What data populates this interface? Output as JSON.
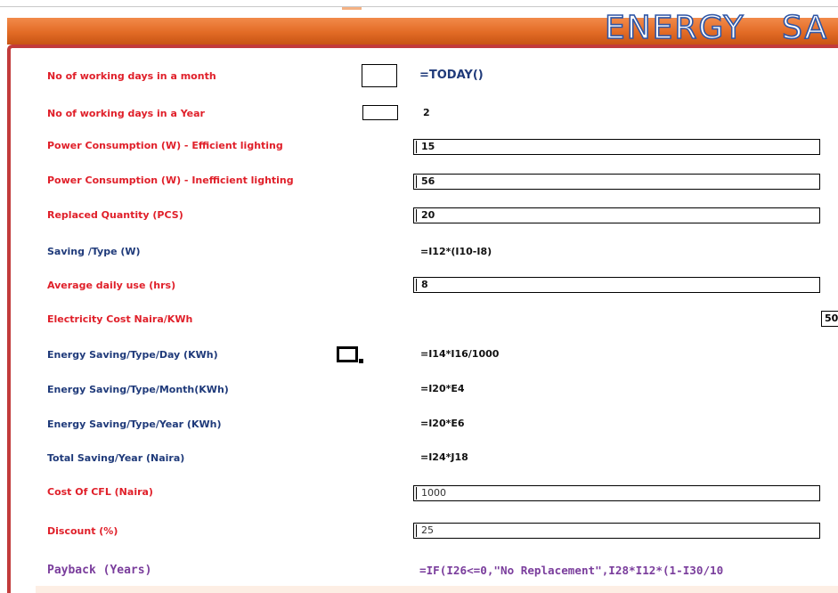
{
  "banner": {
    "title": "ENERGY SA"
  },
  "rows": [
    {
      "label": "No of working days in a month",
      "value": "=TODAY()"
    },
    {
      "label": "No of working days in a Year",
      "value": "2"
    },
    {
      "label": "Power Consumption (W) - Efficient lighting",
      "value": "15"
    },
    {
      "label": "Power Consumption (W) - Inefficient lighting",
      "value": "56"
    },
    {
      "label": "Replaced Quantity (PCS)",
      "value": "20"
    },
    {
      "label": "Saving /Type (W)",
      "value": "=I12*(I10-I8)"
    },
    {
      "label": "Average daily use (hrs)",
      "value": "8"
    },
    {
      "label": "Electricity Cost Naira/KWh",
      "value": "50"
    },
    {
      "label": "Energy Saving/Type/Day (KWh)",
      "value": "=I14*I16/1000"
    },
    {
      "label": "Energy Saving/Type/Month(KWh)",
      "value": "=I20*E4"
    },
    {
      "label": "Energy Saving/Type/Year (KWh)",
      "value": "=I20*E6"
    },
    {
      "label": "Total Saving/Year (Naira)",
      "value": "=I24*J18"
    },
    {
      "label": "Cost Of CFL (Naira)",
      "value": "1000"
    },
    {
      "label": "Discount (%)",
      "value": "25"
    },
    {
      "label": "Payback (Years)",
      "value": "=IF(I26<=0,\"No Replacement\",I28*I12*(1-I30/10"
    }
  ],
  "colors": {
    "label_red": "#e0202a",
    "label_blue": "#1f3a7a",
    "label_purple": "#7a3d9c",
    "banner_orange": "#e26b25",
    "panel_border": "#c23b3b"
  }
}
